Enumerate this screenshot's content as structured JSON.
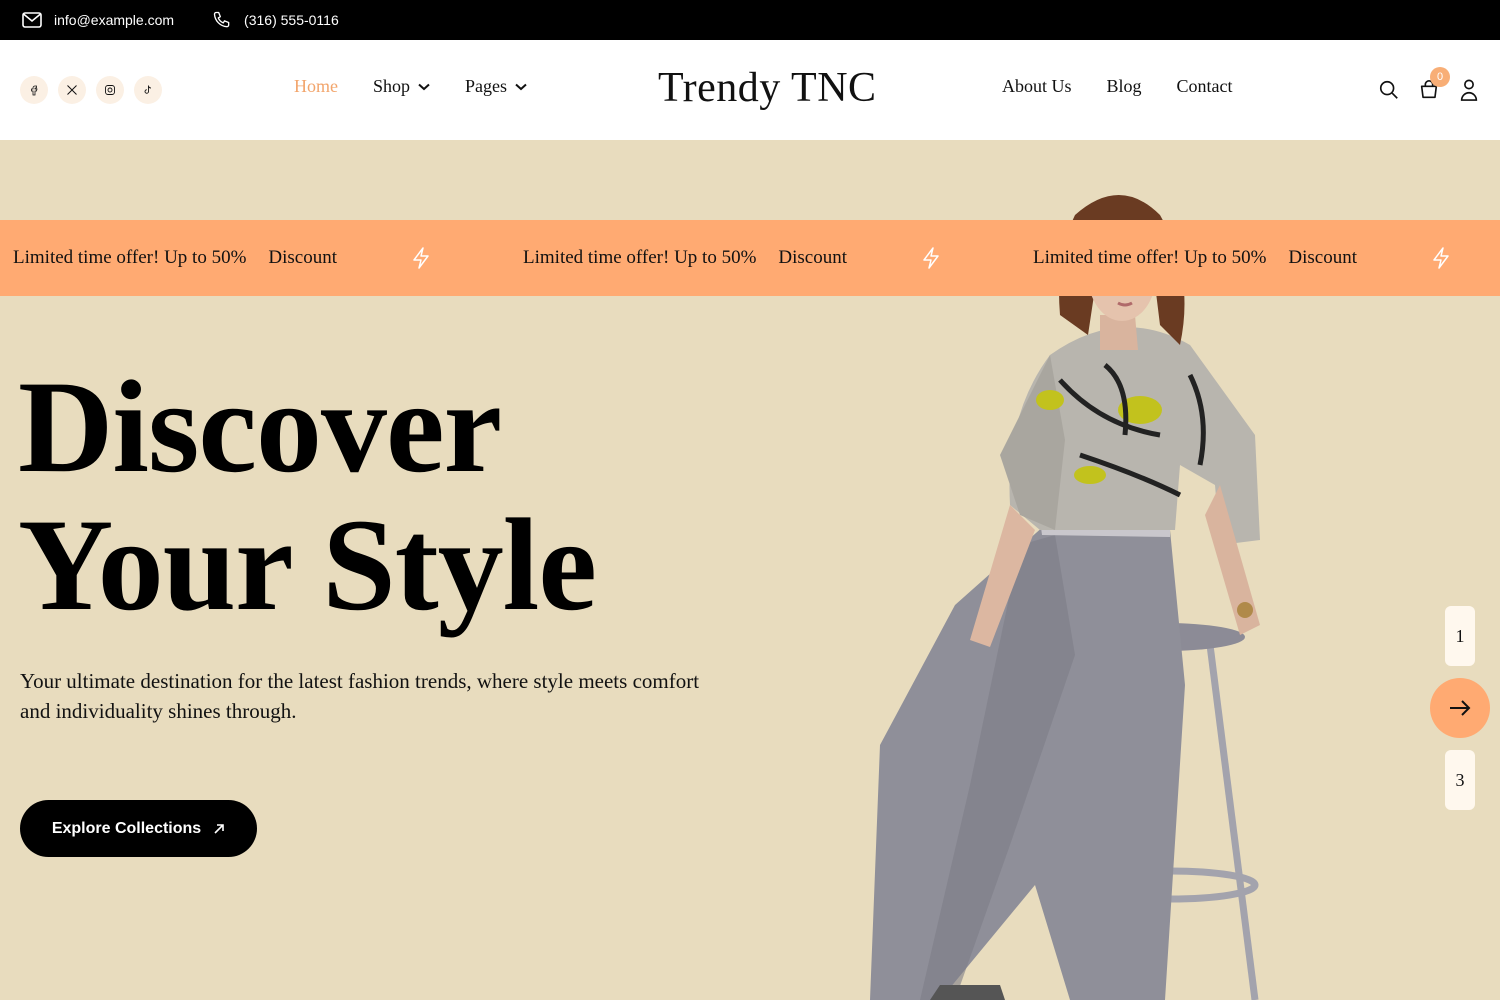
{
  "topbar": {
    "email": "info@example.com",
    "phone": "(316) 555-0116"
  },
  "header": {
    "logo": "Trendy TNC",
    "nav_left": [
      {
        "label": "Home",
        "active": true
      },
      {
        "label": "Shop",
        "dropdown": true
      },
      {
        "label": "Pages",
        "dropdown": true
      }
    ],
    "nav_right": [
      {
        "label": "About Us"
      },
      {
        "label": "Blog"
      },
      {
        "label": "Contact"
      }
    ],
    "socials": [
      "facebook-icon",
      "x-twitter-icon",
      "instagram-icon",
      "tiktok-icon"
    ],
    "cart_count": "0"
  },
  "marquee": {
    "text": "Limited time offer! Up to 50%",
    "discount": "Discount"
  },
  "hero": {
    "title_line1": "Discover",
    "title_line2": "Your Style",
    "subtitle": "Your ultimate destination for the latest fashion trends, where style meets comfort and individuality shines through.",
    "cta_label": "Explore Collections"
  },
  "pager": {
    "page1": "1",
    "page3": "3"
  },
  "colors": {
    "accent": "#ffaa72",
    "hero_bg": "#e8dcbe",
    "active_nav": "#f2a56c"
  }
}
